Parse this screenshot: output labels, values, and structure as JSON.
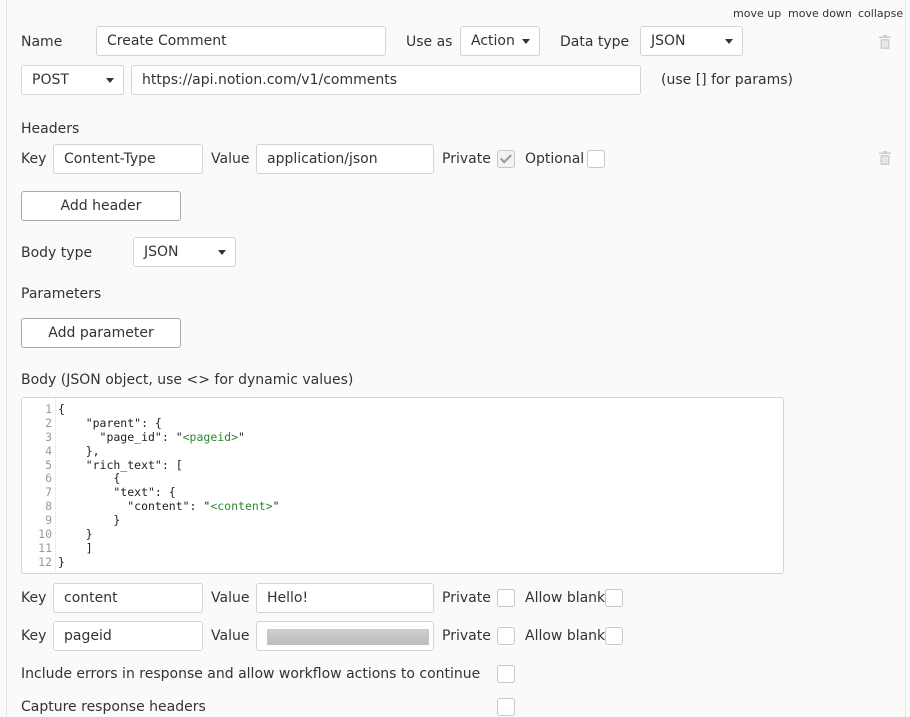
{
  "top_links": {
    "move_up": "move up",
    "move_down": "move down",
    "collapse": "collapse"
  },
  "call": {
    "name_label": "Name",
    "name_value": "Create Comment",
    "use_as_label": "Use as",
    "use_as_value": "Action",
    "data_type_label": "Data type",
    "data_type_value": "JSON",
    "method_value": "POST",
    "url_value": "https://api.notion.com/v1/comments",
    "params_hint": "(use [] for params)"
  },
  "headers": {
    "title": "Headers",
    "key_label": "Key",
    "key_value": "Content-Type",
    "value_label": "Value",
    "value_value": "application/json",
    "private_label": "Private",
    "private_checked": true,
    "optional_label": "Optional",
    "optional_checked": false,
    "add_button": "Add header"
  },
  "body_type": {
    "label": "Body type",
    "value": "JSON"
  },
  "parameters": {
    "title": "Parameters",
    "add_button": "Add parameter"
  },
  "body": {
    "label": "Body (JSON object, use <> for dynamic values)",
    "line_numbers": [
      "1",
      "2",
      "3",
      "4",
      "5",
      "6",
      "7",
      "8",
      "9",
      "10",
      "11",
      "12"
    ],
    "lines": [
      "{",
      "    \"parent\": {",
      "      \"page_id\": \"<pageid>\"",
      "    },",
      "    \"rich_text\": [",
      "        {",
      "        \"text\": {",
      "          \"content\": \"<content>\"",
      "        }",
      "    }",
      "    ]",
      "}"
    ]
  },
  "body_params": [
    {
      "key_label": "Key",
      "key": "content",
      "value_label": "Value",
      "value": "Hello!",
      "private_label": "Private",
      "private_checked": false,
      "blank_label": "Allow blank",
      "blank_checked": false
    },
    {
      "key_label": "Key",
      "key": "pageid",
      "value_label": "Value",
      "value": "",
      "private_label": "Private",
      "private_checked": false,
      "blank_label": "Allow blank",
      "blank_checked": false
    }
  ],
  "options": {
    "include_errors_label": "Include errors in response and allow workflow actions to continue",
    "capture_headers_label": "Capture response headers"
  },
  "icons": {
    "delete": "trash-icon",
    "dropdown": "chevron-down-icon",
    "check": "check-icon"
  }
}
